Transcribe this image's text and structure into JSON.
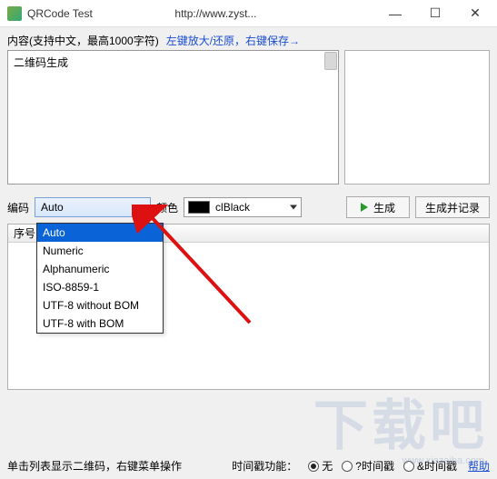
{
  "titlebar": {
    "title": "QRCode Test",
    "url": "http://www.zyst..."
  },
  "labels": {
    "content": "内容(支持中文，最高1000字符)",
    "hint": "左键放大/还原，右键保存→",
    "encoding": "编码",
    "color": "颜色",
    "seq": "序号",
    "footer_hint": "单击列表显示二维码，右键菜单操作",
    "time_func": "时间戳功能："
  },
  "textarea": {
    "value": "二维码生成"
  },
  "encoding_combo": {
    "selected": "Auto",
    "options": [
      "Auto",
      "Numeric",
      "Alphanumeric",
      "ISO-8859-1",
      "UTF-8 without BOM",
      "UTF-8 with BOM"
    ]
  },
  "color_combo": {
    "text": "clBlack",
    "hex": "#000000"
  },
  "buttons": {
    "generate": "生成",
    "generate_record": "生成并记录"
  },
  "radios": {
    "none": "无",
    "qtime": "?时间戳",
    "atime": "&时间戳"
  },
  "help_link": "帮助",
  "watermark": "下载吧",
  "watermark_sub": "www.xiazaiba.com"
}
